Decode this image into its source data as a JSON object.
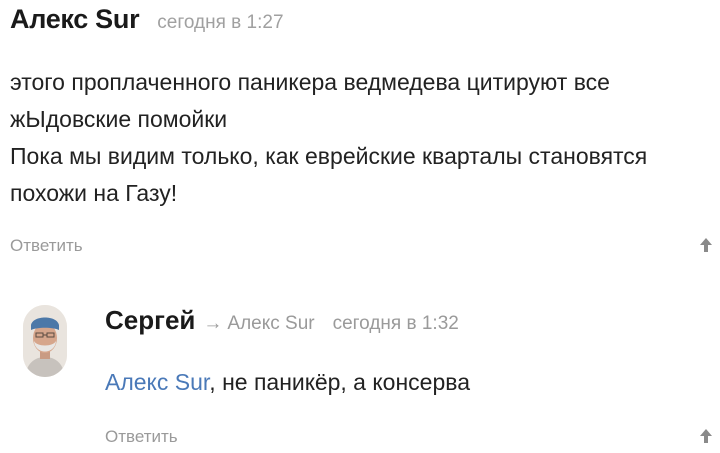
{
  "comments": [
    {
      "author": "Алекс Sur",
      "time": "сегодня в 1:27",
      "paragraphs": [
        "этого проплаченного паникера ведмедева цитируют все жЫдовские помойки",
        "Пока мы видим только, как еврейские кварталы становятся похожи на Газу!"
      ],
      "reply_label": "Ответить",
      "upvote_icon": "arrow-up-icon"
    },
    {
      "author": "Сергей",
      "reply_arrow": "→",
      "reply_to": "Алекс Sur",
      "time": "сегодня в 1:32",
      "mention": "Алекс Sur",
      "text_rest": ", не паникёр, а консерва",
      "reply_label": "Ответить",
      "upvote_icon": "arrow-up-icon",
      "avatar_icon": "user-avatar"
    }
  ],
  "colors": {
    "text": "#222222",
    "muted": "#9a9a9a",
    "link": "#4a79b8"
  }
}
